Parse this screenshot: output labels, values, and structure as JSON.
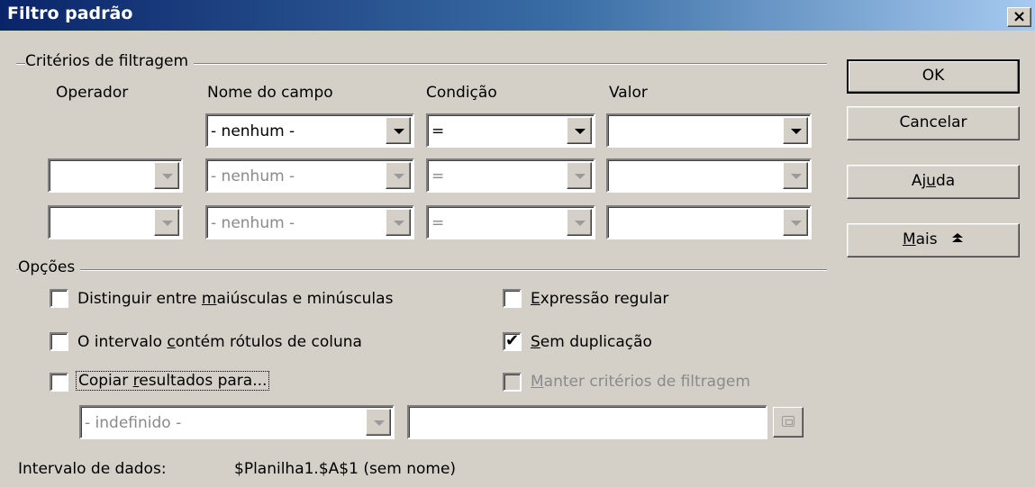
{
  "window": {
    "title": "Filtro padrão",
    "close_glyph": "×"
  },
  "criteria": {
    "group_label": "Critérios de filtragem",
    "headers": {
      "operator": "Operador",
      "field": "Nome do campo",
      "condition": "Condição",
      "value": "Valor"
    },
    "rows": [
      {
        "operator": "",
        "field": "- nenhum -",
        "condition": "=",
        "value": "",
        "enabled": true
      },
      {
        "operator": "",
        "field": "- nenhum -",
        "condition": "=",
        "value": "",
        "enabled": false
      },
      {
        "operator": "",
        "field": "- nenhum -",
        "condition": "=",
        "value": "",
        "enabled": false
      }
    ]
  },
  "buttons": {
    "ok": "OK",
    "cancel": "Cancelar",
    "help_pre": "Aj",
    "help_ul": "u",
    "help_post": "da",
    "more_ul": "M",
    "more_post": "ais",
    "more_icon": "chevron-double-up-icon"
  },
  "options": {
    "group_label": "Opções",
    "case_sensitive": {
      "pre": "Distinguir entre ",
      "ul": "m",
      "post": "aiúsculas e minúsculas",
      "checked": false
    },
    "range_has_labels": {
      "pre": "O intervalo ",
      "ul": "c",
      "post": "ontém rótulos de coluna",
      "checked": false
    },
    "copy_results": {
      "pre": "Copiar ",
      "ul": "r",
      "post": "esultados para...",
      "checked": false
    },
    "regex": {
      "pre": "",
      "ul": "E",
      "post": "xpressão regular",
      "checked": false
    },
    "no_duplicates": {
      "pre": "",
      "ul": "S",
      "post": "em duplicação",
      "checked": true
    },
    "keep_criteria": {
      "pre": "",
      "ul": "M",
      "post": "anter critérios de filtragem",
      "checked": false,
      "enabled": false
    },
    "check_glyph": "✔",
    "copy_target_combo": "- indefinido -",
    "copy_target_text": ""
  },
  "data_range": {
    "label": "Intervalo de dados:",
    "value": "$Planilha1.$A$1 (sem nome)"
  }
}
